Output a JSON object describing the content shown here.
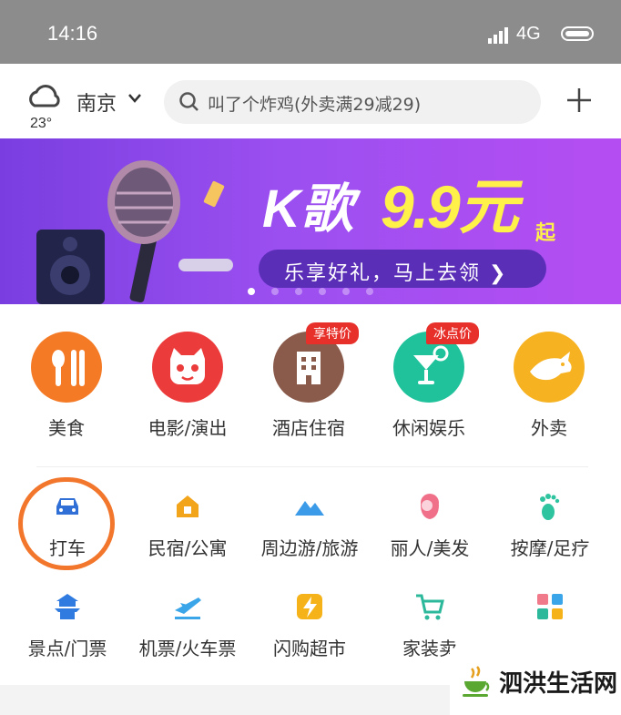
{
  "status_bar": {
    "time": "14:16",
    "network": "4G"
  },
  "header": {
    "temperature": "23°",
    "city": "南京",
    "search_placeholder": "叫了个炸鸡(外卖满29减29)"
  },
  "banner": {
    "title_k": "K歌",
    "title_price": "9.9元",
    "title_suffix": "起",
    "subtitle": "乐享好礼，马上去领 ❯",
    "page_count": 6,
    "active_page": 1
  },
  "primary_categories": [
    {
      "label": "美食",
      "badge": "",
      "color": "#f47a25"
    },
    {
      "label": "电影/演出",
      "badge": "",
      "color": "#ec3b3b"
    },
    {
      "label": "酒店住宿",
      "badge": "享特价",
      "color": "#8a5a4a"
    },
    {
      "label": "休闲娱乐",
      "badge": "冰点价",
      "color": "#20c29b"
    },
    {
      "label": "外卖",
      "badge": "",
      "color": "#f6b221"
    }
  ],
  "secondary_categories": [
    {
      "label": "打车",
      "color": "#2f6fd6"
    },
    {
      "label": "民宿/公寓",
      "color": "#f2a51a"
    },
    {
      "label": "周边游/旅游",
      "color": "#3b9be8"
    },
    {
      "label": "丽人/美发",
      "color": "#f0708a"
    },
    {
      "label": "按摩/足疗",
      "color": "#2ec4a0"
    },
    {
      "label": "景点/门票",
      "color": "#2f7be0"
    },
    {
      "label": "机票/火车票",
      "color": "#3aa5e8"
    },
    {
      "label": "闪购超市",
      "color": "#f5b319"
    },
    {
      "label": "家装卖",
      "color": "#2cb89a"
    },
    {
      "label": "",
      "color": "#8a8a8a"
    }
  ],
  "watermark": {
    "text": "泗洪生活网"
  }
}
